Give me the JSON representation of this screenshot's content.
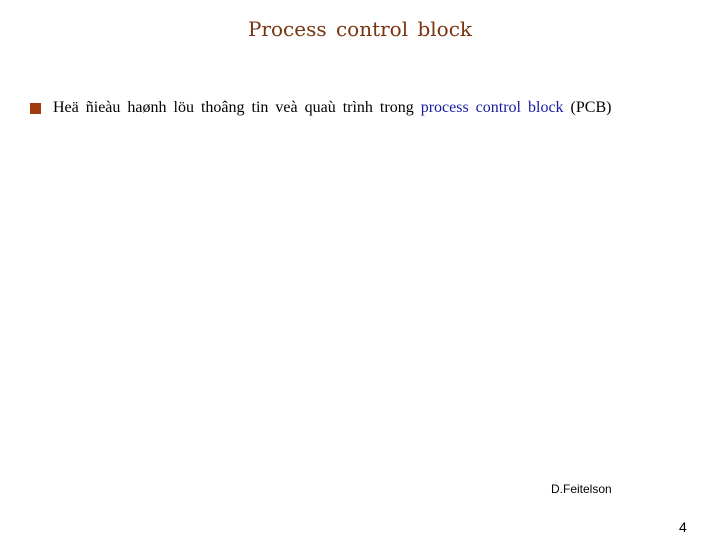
{
  "slide": {
    "title": "Process control block",
    "bullets": [
      {
        "text_before": "Heä ñieàu haønh löu thoâng tin veà quaù trình trong ",
        "highlight": "process control block",
        "text_after": " (PCB)"
      }
    ],
    "author": "D.Feitelson",
    "page_number": "4"
  },
  "colors": {
    "title": "#7a3310",
    "bullet": "#a03b10",
    "highlight": "#1a1aa0",
    "text": "#000000"
  }
}
